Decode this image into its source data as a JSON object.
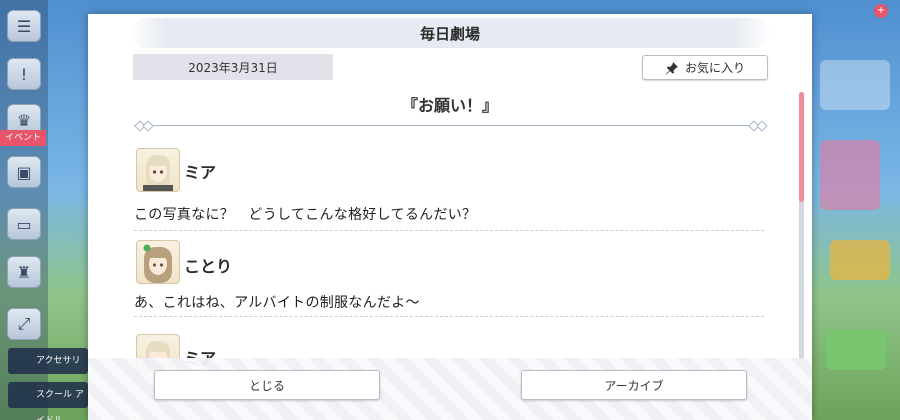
{
  "dialog": {
    "title": "毎日劇場",
    "date": "2023年3月31日",
    "favorite_label": "お気に入り",
    "favorite_icon": "pin-icon",
    "story_title": "『お願い！』",
    "entries": [
      {
        "speaker": "ミア",
        "text": "この写真なに？　どうしてこんな格好してるんだい？"
      },
      {
        "speaker": "ことり",
        "text": "あ、これはね、アルバイトの制服なんだよ〜"
      },
      {
        "speaker": "ミア",
        "text": ""
      }
    ],
    "close_label": "とじる",
    "archive_label": "アーカイブ"
  },
  "background": {
    "event_tag": "イベント",
    "bottom_items": [
      "アクセサリー",
      "スクール アイドル"
    ]
  },
  "colors": {
    "accent_pink": "#f08b9a",
    "title_bar": "#e6eaf2",
    "date_box": "#e2e3ea"
  }
}
